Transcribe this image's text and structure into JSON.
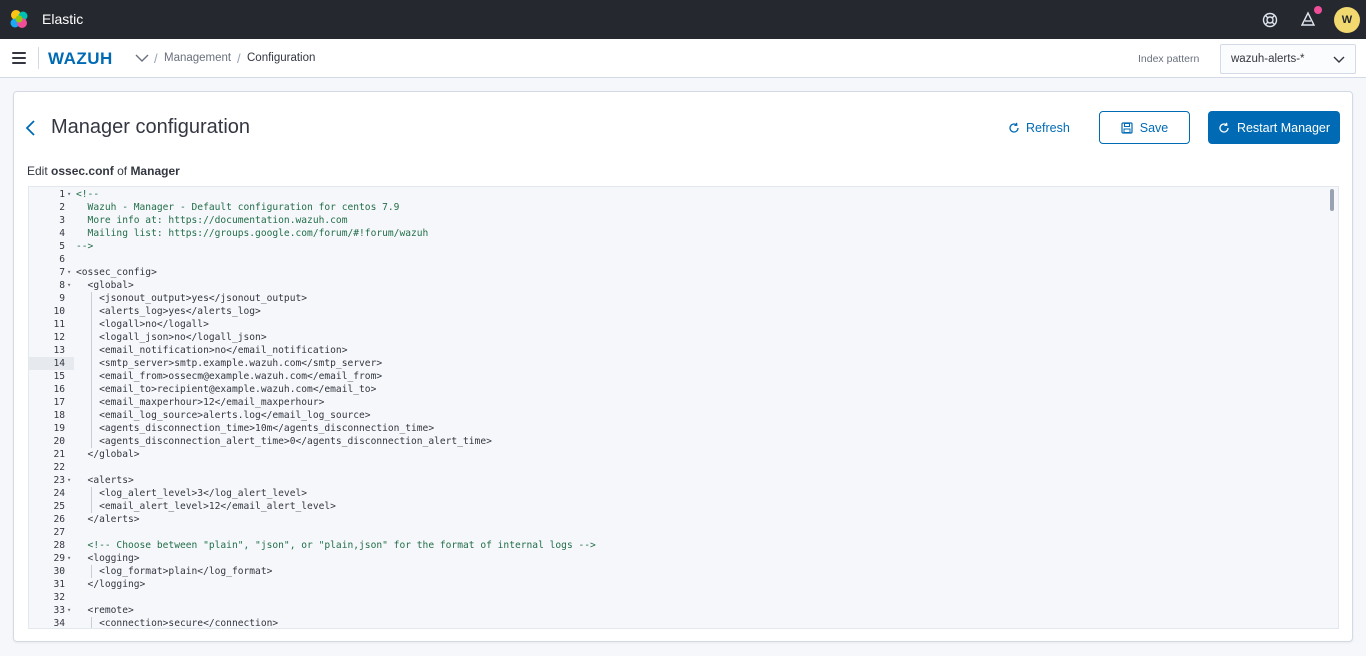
{
  "header": {
    "app_title": "Elastic",
    "avatar_initial": "W",
    "notification_color": "#f04e98"
  },
  "subheader": {
    "brand": "WAZUH",
    "breadcrumb_management": "Management",
    "breadcrumb_configuration": "Configuration",
    "index_pattern_label": "Index pattern",
    "index_pattern_value": "wazuh-alerts-*"
  },
  "panel": {
    "title": "Manager configuration",
    "refresh_label": "Refresh",
    "save_label": "Save",
    "restart_label": "Restart Manager",
    "edit_prefix": "Edit",
    "edit_file": "ossec.conf",
    "edit_of": "of",
    "edit_target": "Manager"
  },
  "colors": {
    "accent": "#006bb4",
    "header_bg": "#25282f"
  },
  "editor": {
    "active_line": 14,
    "lines": [
      {
        "n": "1",
        "fold": true,
        "text": "<!--"
      },
      {
        "n": "2",
        "fold": false,
        "text": "  Wazuh - Manager - Default configuration for centos 7.9"
      },
      {
        "n": "3",
        "fold": false,
        "text": "  More info at: https://documentation.wazuh.com"
      },
      {
        "n": "4",
        "fold": false,
        "text": "  Mailing list: https://groups.google.com/forum/#!forum/wazuh"
      },
      {
        "n": "5",
        "fold": false,
        "text": "-->"
      },
      {
        "n": "6",
        "fold": false,
        "text": ""
      },
      {
        "n": "7",
        "fold": true,
        "text": "<ossec_config>"
      },
      {
        "n": "8",
        "fold": true,
        "text": "  <global>"
      },
      {
        "n": "9",
        "fold": false,
        "text": "    <jsonout_output>yes</jsonout_output>"
      },
      {
        "n": "10",
        "fold": false,
        "text": "    <alerts_log>yes</alerts_log>"
      },
      {
        "n": "11",
        "fold": false,
        "text": "    <logall>no</logall>"
      },
      {
        "n": "12",
        "fold": false,
        "text": "    <logall_json>no</logall_json>"
      },
      {
        "n": "13",
        "fold": false,
        "text": "    <email_notification>no</email_notification>"
      },
      {
        "n": "14",
        "fold": false,
        "text": "    <smtp_server>smtp.example.wazuh.com</smtp_server>"
      },
      {
        "n": "15",
        "fold": false,
        "text": "    <email_from>ossecm@example.wazuh.com</email_from>"
      },
      {
        "n": "16",
        "fold": false,
        "text": "    <email_to>recipient@example.wazuh.com</email_to>"
      },
      {
        "n": "17",
        "fold": false,
        "text": "    <email_maxperhour>12</email_maxperhour>"
      },
      {
        "n": "18",
        "fold": false,
        "text": "    <email_log_source>alerts.log</email_log_source>"
      },
      {
        "n": "19",
        "fold": false,
        "text": "    <agents_disconnection_time>10m</agents_disconnection_time>"
      },
      {
        "n": "20",
        "fold": false,
        "text": "    <agents_disconnection_alert_time>0</agents_disconnection_alert_time>"
      },
      {
        "n": "21",
        "fold": false,
        "text": "  </global>"
      },
      {
        "n": "22",
        "fold": false,
        "text": ""
      },
      {
        "n": "23",
        "fold": true,
        "text": "  <alerts>"
      },
      {
        "n": "24",
        "fold": false,
        "text": "    <log_alert_level>3</log_alert_level>"
      },
      {
        "n": "25",
        "fold": false,
        "text": "    <email_alert_level>12</email_alert_level>"
      },
      {
        "n": "26",
        "fold": false,
        "text": "  </alerts>"
      },
      {
        "n": "27",
        "fold": false,
        "text": ""
      },
      {
        "n": "28",
        "fold": false,
        "text": "  <!-- Choose between \"plain\", \"json\", or \"plain,json\" for the format of internal logs -->"
      },
      {
        "n": "29",
        "fold": true,
        "text": "  <logging>"
      },
      {
        "n": "30",
        "fold": false,
        "text": "    <log_format>plain</log_format>"
      },
      {
        "n": "31",
        "fold": false,
        "text": "  </logging>"
      },
      {
        "n": "32",
        "fold": false,
        "text": ""
      },
      {
        "n": "33",
        "fold": true,
        "text": "  <remote>"
      },
      {
        "n": "34",
        "fold": false,
        "text": "    <connection>secure</connection>"
      }
    ]
  }
}
